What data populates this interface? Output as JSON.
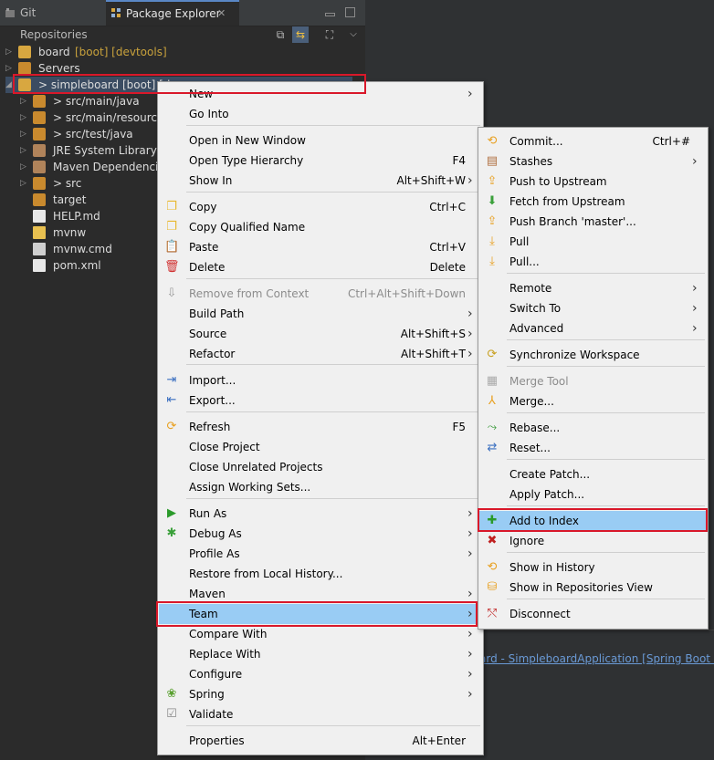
{
  "tabs": {
    "git_repositories": "Git Repositories",
    "package_explorer": "Package Explorer"
  },
  "tree": [
    {
      "label": "board",
      "decoration": "[boot] [devtools]",
      "arrow": "▷"
    },
    {
      "label": "Servers",
      "decoration": "",
      "arrow": "▷"
    },
    {
      "label": "> simpleboard [boot] [de",
      "decoration": "",
      "arrow": "◢"
    },
    {
      "label": "> src/main/java",
      "decoration": "",
      "arrow": "▷"
    },
    {
      "label": "> src/main/resources",
      "decoration": "",
      "arrow": "▷"
    },
    {
      "label": "> src/test/java",
      "decoration": "",
      "arrow": "▷"
    },
    {
      "label": "JRE System Library",
      "decoration": "[Ja",
      "arrow": "▷"
    },
    {
      "label": "Maven Dependencies",
      "decoration": "",
      "arrow": "▷"
    },
    {
      "label": "> src",
      "decoration": "",
      "arrow": "▷"
    },
    {
      "label": "target",
      "decoration": "",
      "arrow": ""
    },
    {
      "label": "HELP.md",
      "decoration": "",
      "arrow": ""
    },
    {
      "label": "mvnw",
      "decoration": "",
      "arrow": ""
    },
    {
      "label": "mvnw.cmd",
      "decoration": "",
      "arrow": ""
    },
    {
      "label": "pom.xml",
      "decoration": "",
      "arrow": ""
    }
  ],
  "context_menu": [
    {
      "label": "New",
      "shortcut": "",
      "submenu": true,
      "icon": ""
    },
    {
      "label": "Go Into",
      "shortcut": "",
      "submenu": false,
      "icon": ""
    },
    {
      "label": "Open in New Window",
      "shortcut": "",
      "submenu": false,
      "icon": ""
    },
    {
      "label": "Open Type Hierarchy",
      "shortcut": "F4",
      "submenu": false,
      "icon": ""
    },
    {
      "label": "Show In",
      "shortcut": "Alt+Shift+W",
      "submenu": true,
      "icon": ""
    },
    {
      "label": "Copy",
      "shortcut": "Ctrl+C",
      "submenu": false,
      "icon": "copy-icon"
    },
    {
      "label": "Copy Qualified Name",
      "shortcut": "",
      "submenu": false,
      "icon": "copy-qualified-icon"
    },
    {
      "label": "Paste",
      "shortcut": "Ctrl+V",
      "submenu": false,
      "icon": "paste-icon"
    },
    {
      "label": "Delete",
      "shortcut": "Delete",
      "submenu": false,
      "icon": "delete-icon"
    },
    {
      "label": "Remove from Context",
      "shortcut": "Ctrl+Alt+Shift+Down",
      "submenu": false,
      "icon": "remove-context-icon",
      "disabled": true
    },
    {
      "label": "Build Path",
      "shortcut": "",
      "submenu": true,
      "icon": ""
    },
    {
      "label": "Source",
      "shortcut": "Alt+Shift+S",
      "submenu": true,
      "icon": ""
    },
    {
      "label": "Refactor",
      "shortcut": "Alt+Shift+T",
      "submenu": true,
      "icon": ""
    },
    {
      "label": "Import...",
      "shortcut": "",
      "submenu": false,
      "icon": "import-icon"
    },
    {
      "label": "Export...",
      "shortcut": "",
      "submenu": false,
      "icon": "export-icon"
    },
    {
      "label": "Refresh",
      "shortcut": "F5",
      "submenu": false,
      "icon": "refresh-icon"
    },
    {
      "label": "Close Project",
      "shortcut": "",
      "submenu": false,
      "icon": ""
    },
    {
      "label": "Close Unrelated Projects",
      "shortcut": "",
      "submenu": false,
      "icon": ""
    },
    {
      "label": "Assign Working Sets...",
      "shortcut": "",
      "submenu": false,
      "icon": ""
    },
    {
      "label": "Run As",
      "shortcut": "",
      "submenu": true,
      "icon": "run-icon"
    },
    {
      "label": "Debug As",
      "shortcut": "",
      "submenu": true,
      "icon": "debug-icon"
    },
    {
      "label": "Profile As",
      "shortcut": "",
      "submenu": true,
      "icon": ""
    },
    {
      "label": "Restore from Local History...",
      "shortcut": "",
      "submenu": false,
      "icon": ""
    },
    {
      "label": "Maven",
      "shortcut": "",
      "submenu": true,
      "icon": ""
    },
    {
      "label": "Team",
      "shortcut": "",
      "submenu": true,
      "icon": "",
      "highlight": true
    },
    {
      "label": "Compare With",
      "shortcut": "",
      "submenu": true,
      "icon": ""
    },
    {
      "label": "Replace With",
      "shortcut": "",
      "submenu": true,
      "icon": ""
    },
    {
      "label": "Configure",
      "shortcut": "",
      "submenu": true,
      "icon": ""
    },
    {
      "label": "Spring",
      "shortcut": "",
      "submenu": true,
      "icon": "spring-icon"
    },
    {
      "label": "Validate",
      "shortcut": "",
      "submenu": false,
      "icon": "validate-icon"
    },
    {
      "label": "Properties",
      "shortcut": "Alt+Enter",
      "submenu": false,
      "icon": ""
    }
  ],
  "team_menu": [
    {
      "label": "Commit...",
      "shortcut": "Ctrl+#",
      "submenu": false,
      "icon": "commit-icon"
    },
    {
      "label": "Stashes",
      "shortcut": "",
      "submenu": true,
      "icon": "stash-icon"
    },
    {
      "label": "Push to Upstream",
      "shortcut": "",
      "submenu": false,
      "icon": "push-upstream-icon"
    },
    {
      "label": "Fetch from Upstream",
      "shortcut": "",
      "submenu": false,
      "icon": "fetch-upstream-icon"
    },
    {
      "label": "Push Branch 'master'...",
      "shortcut": "",
      "submenu": false,
      "icon": "push-branch-icon"
    },
    {
      "label": "Pull",
      "shortcut": "",
      "submenu": false,
      "icon": "pull-icon"
    },
    {
      "label": "Pull...",
      "shortcut": "",
      "submenu": false,
      "icon": "pull-dialog-icon"
    },
    {
      "label": "Remote",
      "shortcut": "",
      "submenu": true,
      "icon": ""
    },
    {
      "label": "Switch To",
      "shortcut": "",
      "submenu": true,
      "icon": ""
    },
    {
      "label": "Advanced",
      "shortcut": "",
      "submenu": true,
      "icon": ""
    },
    {
      "label": "Synchronize Workspace",
      "shortcut": "",
      "submenu": false,
      "icon": "synchronize-icon"
    },
    {
      "label": "Merge Tool",
      "shortcut": "",
      "submenu": false,
      "icon": "merge-tool-icon",
      "disabled": true
    },
    {
      "label": "Merge...",
      "shortcut": "",
      "submenu": false,
      "icon": "merge-icon"
    },
    {
      "label": "Rebase...",
      "shortcut": "",
      "submenu": false,
      "icon": "rebase-icon"
    },
    {
      "label": "Reset...",
      "shortcut": "",
      "submenu": false,
      "icon": "reset-icon"
    },
    {
      "label": "Create Patch...",
      "shortcut": "",
      "submenu": false,
      "icon": ""
    },
    {
      "label": "Apply Patch...",
      "shortcut": "",
      "submenu": false,
      "icon": ""
    },
    {
      "label": "Add to Index",
      "shortcut": "",
      "submenu": false,
      "icon": "add-to-index-icon",
      "highlight": true
    },
    {
      "label": "Ignore",
      "shortcut": "",
      "submenu": false,
      "icon": "ignore-icon"
    },
    {
      "label": "Show in History",
      "shortcut": "",
      "submenu": false,
      "icon": "history-icon"
    },
    {
      "label": "Show in Repositories View",
      "shortcut": "",
      "submenu": false,
      "icon": "repositories-view-icon"
    },
    {
      "label": "Disconnect",
      "shortcut": "",
      "submenu": false,
      "icon": "disconnect-icon"
    }
  ],
  "console_line": "ard - SimpleboardApplication [Spring Boot App"
}
